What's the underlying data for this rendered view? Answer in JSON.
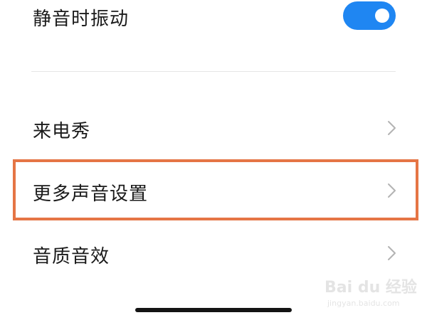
{
  "settings": {
    "vibrate_on_silent": {
      "label": "静音时振动",
      "enabled": true
    },
    "items": [
      {
        "label": "来电秀"
      },
      {
        "label": "更多声音设置",
        "highlighted": true
      },
      {
        "label": "音质音效"
      }
    ]
  },
  "colors": {
    "toggle_on": "#1f86f2",
    "highlight_border": "#e57545",
    "text": "#1a1a1a",
    "chevron": "#b3b3b3"
  },
  "icons": {
    "item_arrow": "chevron-right-icon"
  },
  "watermark": {
    "brand": "Bai du 经验",
    "site": "jingyan.baidu.com"
  }
}
